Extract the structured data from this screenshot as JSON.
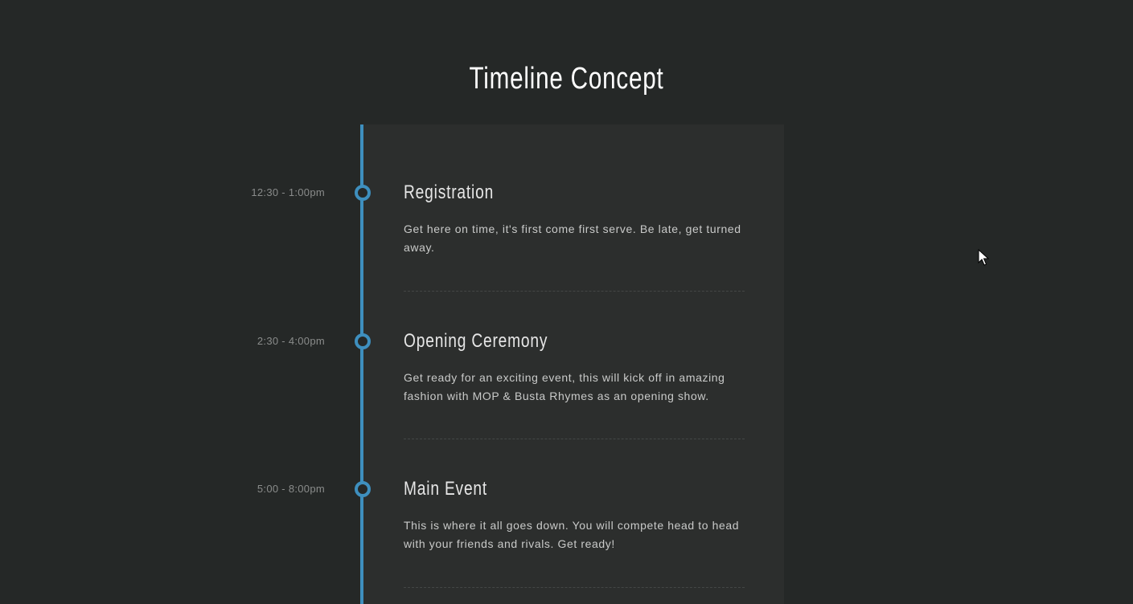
{
  "page": {
    "title": "Timeline Concept"
  },
  "colors": {
    "background": "#252827",
    "card": "#2c2e2d",
    "accent": "#3e8fbe",
    "title": "#ffffff",
    "text": "#c9cac9",
    "time": "#8a8c8b"
  },
  "timeline": {
    "events": [
      {
        "time": "12:30 - 1:00pm",
        "title": "Registration",
        "description": "Get here on time, it's first come first serve. Be late, get turned away."
      },
      {
        "time": "2:30 - 4:00pm",
        "title": "Opening Ceremony",
        "description": "Get ready for an exciting event, this will kick off in amazing fashion with MOP & Busta Rhymes as an opening show."
      },
      {
        "time": "5:00 - 8:00pm",
        "title": "Main Event",
        "description": "This is where it all goes down. You will compete head to head with your friends and rivals. Get ready!"
      }
    ]
  },
  "cursor": {
    "icon": "cursor-arrow-icon"
  }
}
